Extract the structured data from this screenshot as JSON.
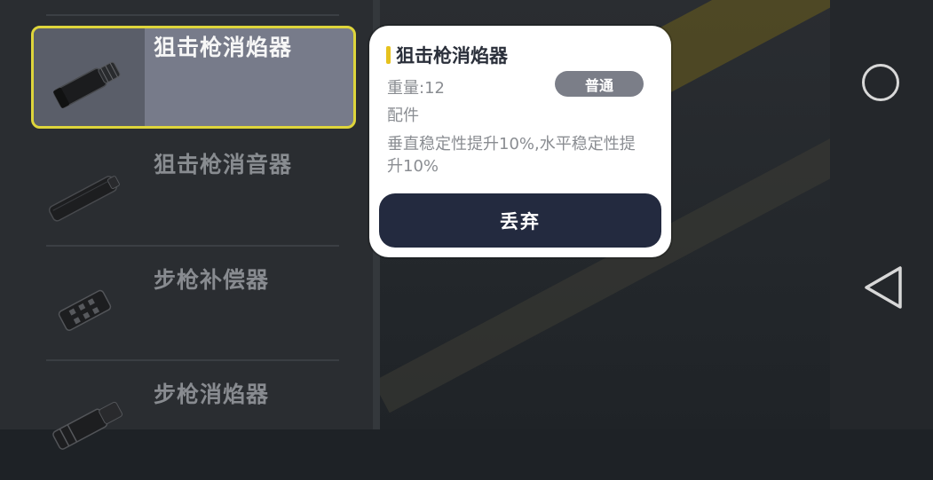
{
  "inventory": {
    "items": [
      {
        "name": "狙击枪消焰器",
        "icon": "sniper-flash-hider-icon",
        "selected": true
      },
      {
        "name": "狙击枪消音器",
        "icon": "sniper-suppressor-icon",
        "selected": false
      },
      {
        "name": "步枪补偿器",
        "icon": "rifle-compensator-icon",
        "selected": false
      },
      {
        "name": "步枪消焰器",
        "icon": "rifle-flash-hider-icon",
        "selected": false
      }
    ]
  },
  "detail": {
    "title": "狙击枪消焰器",
    "weight": "重量:12",
    "rarity_badge": "普通",
    "type": "配件",
    "description": "垂直稳定性提升10%,水平稳定性提升10%",
    "discard_label": "丢弃"
  },
  "colors": {
    "selection_border": "#e6dc3c",
    "accent_bar": "#e6c21e",
    "discard_button": "#232a3f",
    "badge": "#7b7e88"
  },
  "navigation": {
    "home_icon": "home-circle-icon",
    "back_icon": "back-triangle-icon"
  }
}
